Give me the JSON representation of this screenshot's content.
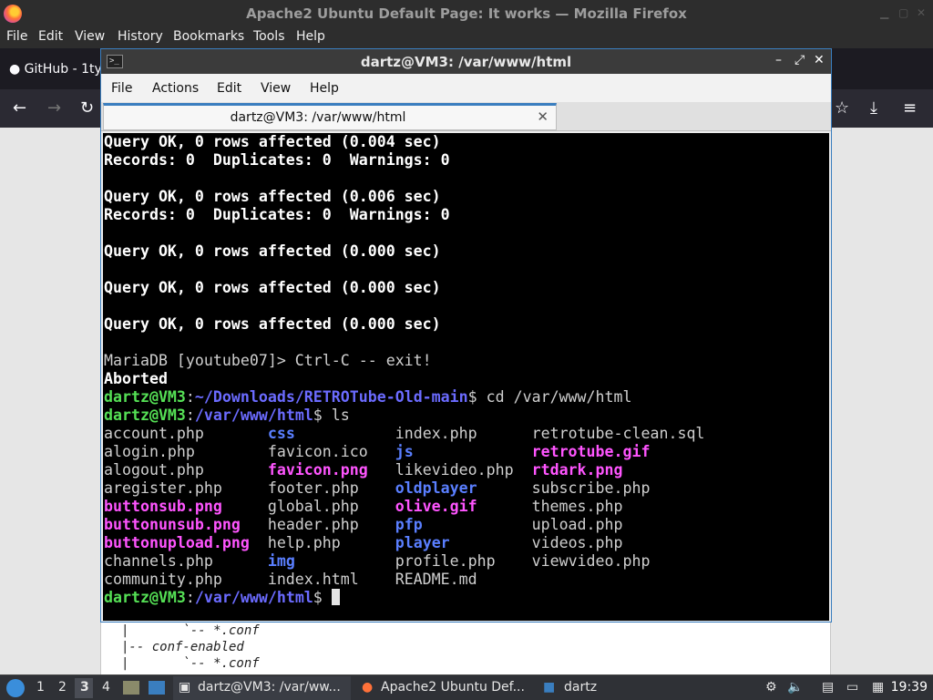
{
  "firefox": {
    "window_title": "Apache2 Ubuntu Default Page: It works — Mozilla Firefox",
    "menu": [
      "File",
      "Edit",
      "View",
      "History",
      "Bookmarks",
      "Tools",
      "Help"
    ],
    "tab_github": "GitHub - 1ty",
    "page_text": "|       `-- *.conf\n|-- conf-enabled\n|       `-- *.conf"
  },
  "terminal": {
    "window_title": "dartz@VM3: /var/www/html",
    "menu": [
      "File",
      "Actions",
      "Edit",
      "View",
      "Help"
    ],
    "tab_label": "dartz@VM3: /var/www/html",
    "tab_close": "✕",
    "lines": {
      "l1": "Query OK, 0 rows affected (0.004 sec)",
      "l2": "Records: 0  Duplicates: 0  Warnings: 0",
      "l3": "Query OK, 0 rows affected (0.006 sec)",
      "l4": "Records: 0  Duplicates: 0  Warnings: 0",
      "l5": "Query OK, 0 rows affected (0.000 sec)",
      "l6": "Query OK, 0 rows affected (0.000 sec)",
      "l7": "Query OK, 0 rows affected (0.000 sec)",
      "l8": "MariaDB [youtube07]> Ctrl-C -- exit!",
      "l9": "Aborted"
    },
    "prompt_user": "dartz@VM3",
    "colon": ":",
    "path_downloads": "~/Downloads/RETROTube-Old-main",
    "dollar": "$",
    "cmd_cd": " cd /var/www/html",
    "path_html": "/var/www/html",
    "cmd_ls": " ls",
    "ls": {
      "c1": [
        "account.php",
        "alogin.php",
        "alogout.php",
        "aregister.php",
        "buttonsub.png",
        "buttonunsub.png",
        "buttonupload.png",
        "channels.php",
        "community.php"
      ],
      "c2": [
        "css",
        "favicon.ico",
        "favicon.png",
        "footer.php",
        "global.php",
        "header.php",
        "help.php",
        "img",
        "index.html"
      ],
      "c3": [
        "index.php",
        "js",
        "likevideo.php",
        "oldplayer",
        "olive.gif",
        "pfp",
        "player",
        "profile.php",
        "README.md"
      ],
      "c4": [
        "retrotube-clean.sql",
        "retrotube.gif",
        "rtdark.png",
        "subscribe.php",
        "themes.php",
        "upload.php",
        "videos.php",
        "viewvideo.php"
      ]
    }
  },
  "taskbar": {
    "workspaces": [
      "1",
      "2",
      "3",
      "4"
    ],
    "terminal_task": "dartz@VM3: /var/ww...",
    "firefox_task": "Apache2 Ubuntu Def...",
    "files_task": "dartz",
    "clock": "19:39"
  }
}
